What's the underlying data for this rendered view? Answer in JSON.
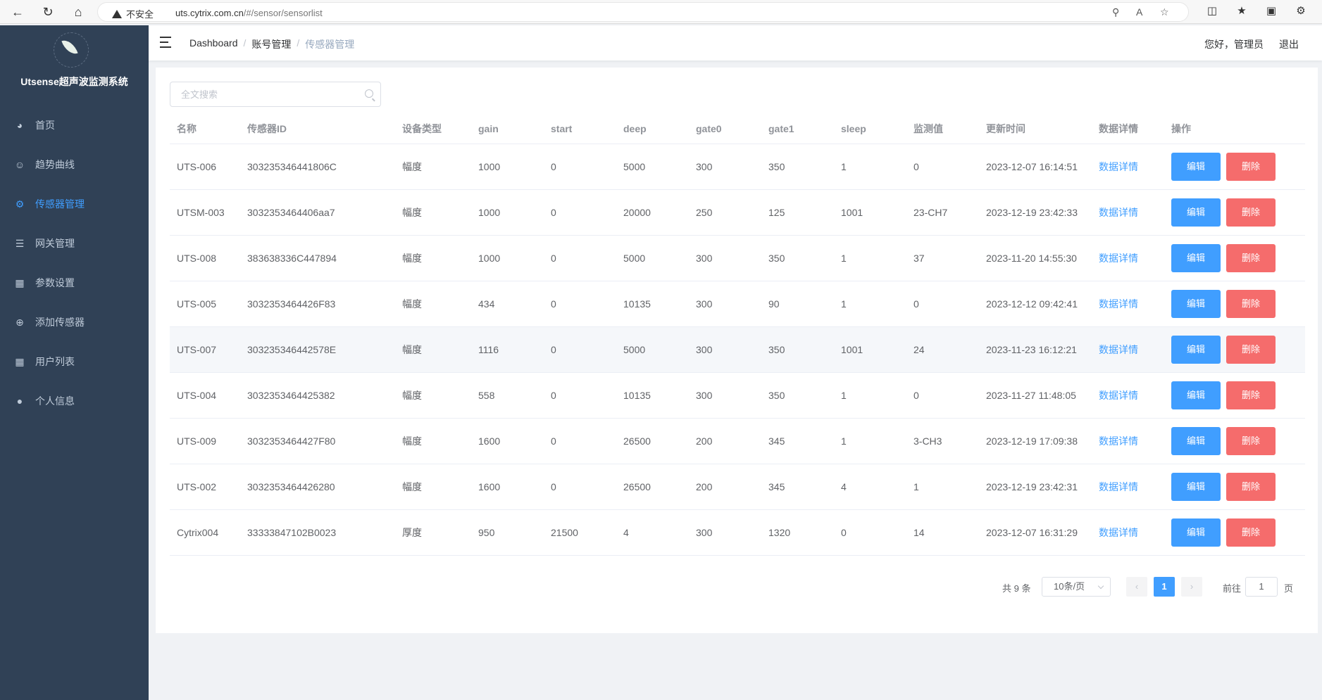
{
  "browser": {
    "security_label": "不安全",
    "url_host": "uts.cytrix.com.cn",
    "url_path": "/#/sensor/sensorlist"
  },
  "sidebar": {
    "title": "Utsense超声波监测系统",
    "items": [
      {
        "label": "首页",
        "icon": "dashboard-icon"
      },
      {
        "label": "趋势曲线",
        "icon": "chart-icon"
      },
      {
        "label": "传感器管理",
        "icon": "chip-icon",
        "active": true
      },
      {
        "label": "网关管理",
        "icon": "sliders-icon"
      },
      {
        "label": "参数设置",
        "icon": "grid-icon"
      },
      {
        "label": "添加传感器",
        "icon": "plus-circle-icon"
      },
      {
        "label": "用户列表",
        "icon": "table-icon"
      },
      {
        "label": "个人信息",
        "icon": "user-icon"
      }
    ]
  },
  "navbar": {
    "breadcrumb": [
      "Dashboard",
      "账号管理",
      "传感器管理"
    ],
    "greeting": "您好，管理员",
    "logout": "退出"
  },
  "search": {
    "placeholder": "全文搜索"
  },
  "table": {
    "headers": [
      "名称",
      "传感器ID",
      "设备类型",
      "gain",
      "start",
      "deep",
      "gate0",
      "gate1",
      "sleep",
      "监测值",
      "更新时间",
      "数据详情",
      "操作"
    ],
    "rows": [
      [
        "UTS-006",
        "303235346441806C",
        "幅度",
        "1000",
        "0",
        "5000",
        "300",
        "350",
        "1",
        "0",
        "2023-12-07 16:14:51"
      ],
      [
        "UTSM-003",
        "3032353464406aa7",
        "幅度",
        "1000",
        "0",
        "20000",
        "250",
        "125",
        "1001",
        "23-CH7",
        "2023-12-19 23:42:33"
      ],
      [
        "UTS-008",
        "383638336C447894",
        "幅度",
        "1000",
        "0",
        "5000",
        "300",
        "350",
        "1",
        "37",
        "2023-11-20 14:55:30"
      ],
      [
        "UTS-005",
        "3032353464426F83",
        "幅度",
        "434",
        "0",
        "10135",
        "300",
        "90",
        "1",
        "0",
        "2023-12-12 09:42:41"
      ],
      [
        "UTS-007",
        "303235346442578E",
        "幅度",
        "1116",
        "0",
        "5000",
        "300",
        "350",
        "1001",
        "24",
        "2023-11-23 16:12:21"
      ],
      [
        "UTS-004",
        "3032353464425382",
        "幅度",
        "558",
        "0",
        "10135",
        "300",
        "350",
        "1",
        "0",
        "2023-11-27 11:48:05"
      ],
      [
        "UTS-009",
        "3032353464427F80",
        "幅度",
        "1600",
        "0",
        "26500",
        "200",
        "345",
        "1",
        "3-CH3",
        "2023-12-19 17:09:38"
      ],
      [
        "UTS-002",
        "3032353464426280",
        "幅度",
        "1600",
        "0",
        "26500",
        "200",
        "345",
        "4",
        "1",
        "2023-12-19 23:42:31"
      ],
      [
        "Cytrix004",
        "33333847102B0023",
        "厚度",
        "950",
        "21500",
        "4",
        "300",
        "1320",
        "0",
        "14",
        "2023-12-07 16:31:29"
      ]
    ],
    "detail_label": "数据详情",
    "edit_label": "编辑",
    "delete_label": "删除"
  },
  "pagination": {
    "total": "共 9 条",
    "page_size": "10条/页",
    "current_page": "1",
    "goto_prefix": "前往",
    "goto_value": "1",
    "goto_suffix": "页"
  },
  "colors": {
    "sidebar_bg": "#304156",
    "primary": "#409eff",
    "danger": "#f56c6c"
  }
}
